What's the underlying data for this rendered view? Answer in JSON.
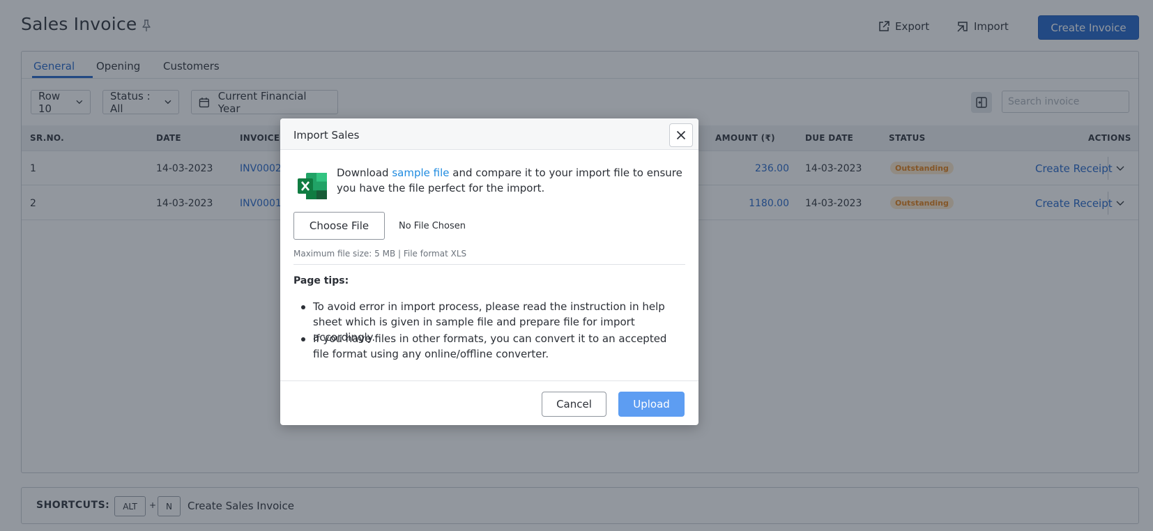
{
  "header": {
    "title": "Sales Invoice",
    "export_label": "Export",
    "import_label": "Import",
    "create_label": "Create Invoice"
  },
  "tabs": [
    {
      "label": "General",
      "active": true
    },
    {
      "label": "Opening",
      "active": false
    },
    {
      "label": "Customers",
      "active": false
    }
  ],
  "filters": {
    "row": "Row 10",
    "status": "Status : All",
    "period": "Current Financial Year",
    "search_placeholder": "Search invoice"
  },
  "table": {
    "columns": [
      "SR.NO.",
      "DATE",
      "INVOICE",
      "AMOUNT (₹)",
      "DUE DATE",
      "STATUS",
      "ACTIONS"
    ],
    "rows": [
      {
        "sr": "1",
        "date": "14-03-2023",
        "invoice": "INV0002",
        "amount": "236.00",
        "due": "14-03-2023",
        "status": "Outstanding",
        "action": "Create Receipt"
      },
      {
        "sr": "2",
        "date": "14-03-2023",
        "invoice": "INV0001",
        "amount": "1180.00",
        "due": "14-03-2023",
        "status": "Outstanding",
        "action": "Create Receipt"
      }
    ]
  },
  "shortcuts": {
    "label": "SHORTCUTS:",
    "key1": "ALT",
    "plus": "+",
    "key2": "N",
    "text": "Create Sales Invoice"
  },
  "modal": {
    "title": "Import Sales",
    "intro_before": "Download ",
    "intro_link": "sample file",
    "intro_after": " and compare it to your import file to ensure you have the file perfect for the import.",
    "choose_label": "Choose File",
    "no_file": "No File Chosen",
    "max_size": "Maximum file size: 5 MB | File format XLS",
    "tips_title": "Page tips:",
    "tips": [
      "To avoid error in import process, please read the instruction in help sheet which is given in sample file and prepare file for import accordingly.",
      "If you have files in other formats, you can convert it to an accepted file format using any online/offline converter."
    ],
    "cancel_label": "Cancel",
    "upload_label": "Upload"
  },
  "colors": {
    "primary": "#1f62c8",
    "upload_disabled": "#5d9df2",
    "link": "#1f8be0",
    "badge_bg": "#fde6c9",
    "badge_text": "#e27d12"
  }
}
